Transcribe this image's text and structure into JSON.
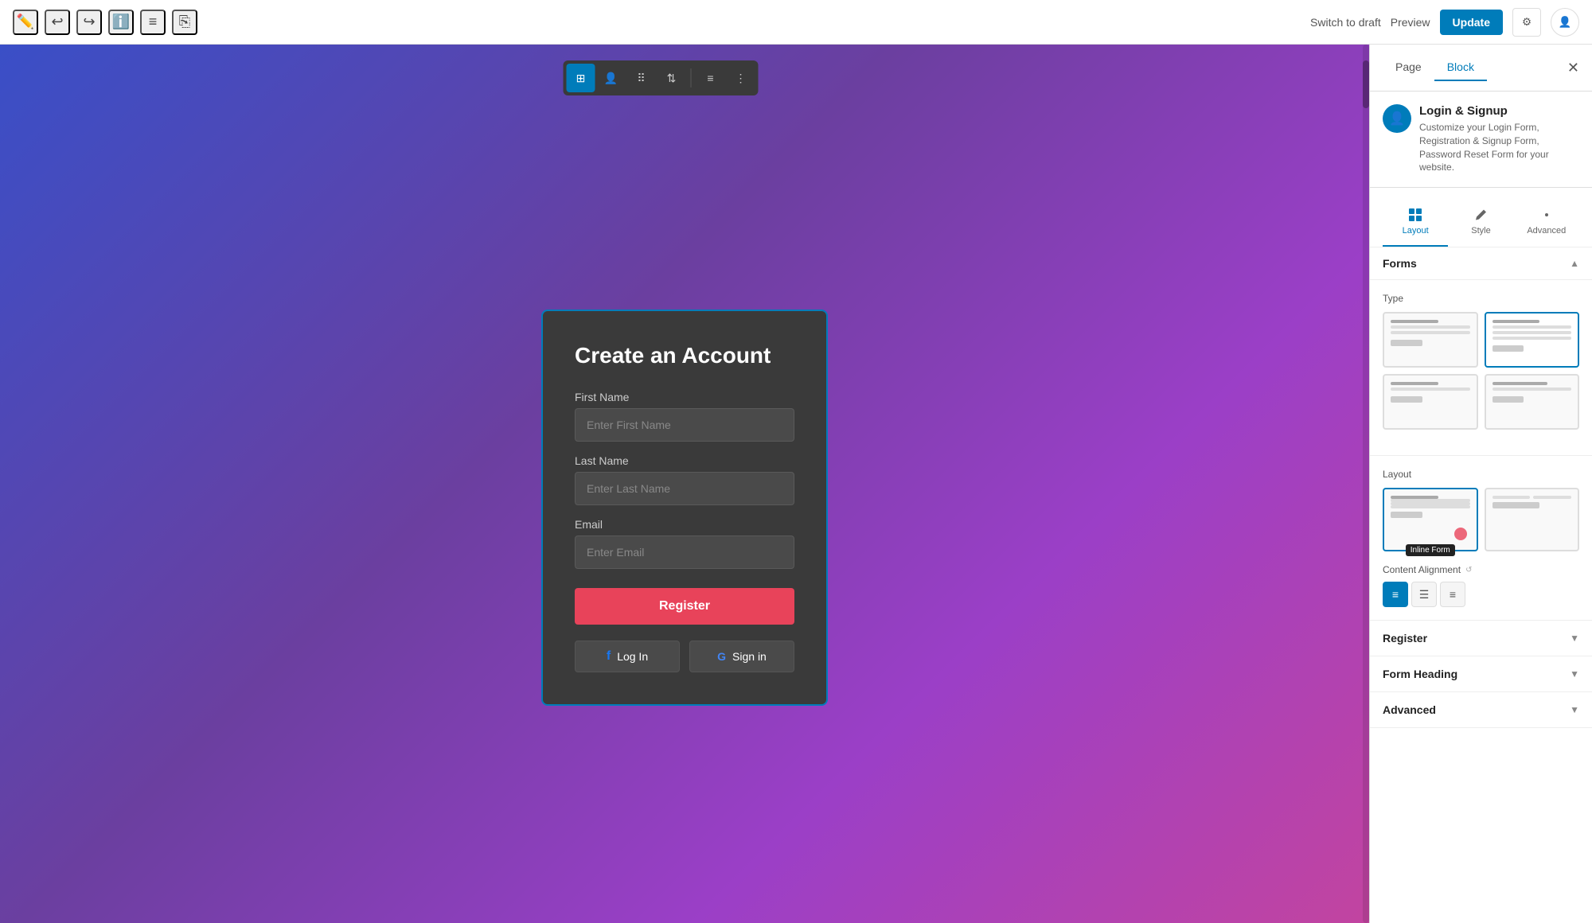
{
  "toolbar": {
    "switch_draft_label": "Switch to draft",
    "preview_label": "Preview",
    "update_label": "Update"
  },
  "panel": {
    "tabs": [
      "Page",
      "Block"
    ],
    "active_tab": "Block",
    "plugin_name": "Login & Signup",
    "plugin_desc": "Customize your Login Form, Registration & Signup Form, Password Reset Form for your website.",
    "tab_icons": [
      "Layout",
      "Style",
      "Advanced"
    ],
    "active_tab_icon": "Layout"
  },
  "forms_section": {
    "label": "Forms",
    "type_label": "Type",
    "types": [
      {
        "id": "type1",
        "label": ""
      },
      {
        "id": "type2",
        "label": "",
        "selected": true
      },
      {
        "id": "type3",
        "label": ""
      },
      {
        "id": "type4",
        "label": ""
      }
    ]
  },
  "layout_section": {
    "label": "Layout",
    "layouts": [
      {
        "id": "inline-form",
        "label": "Inline Form",
        "selected": true,
        "tooltip": "Inline Form"
      },
      {
        "id": "layout2",
        "label": "",
        "selected": false
      }
    ],
    "content_alignment_label": "Content Alignment",
    "alignments": [
      "left",
      "center",
      "right"
    ],
    "active_alignment": "left"
  },
  "form_card": {
    "title": "Create an Account",
    "fields": [
      {
        "label": "First Name",
        "placeholder": "Enter First Name",
        "type": "text"
      },
      {
        "label": "Last Name",
        "placeholder": "Enter Last Name",
        "type": "text"
      },
      {
        "label": "Email",
        "placeholder": "Enter Email",
        "type": "email"
      }
    ],
    "register_button": "Register",
    "social_buttons": [
      {
        "icon": "facebook",
        "label": "Log In"
      },
      {
        "icon": "google",
        "label": "Sign in"
      }
    ]
  },
  "collapsed_sections": [
    {
      "label": "Register"
    },
    {
      "label": "Form Heading"
    },
    {
      "label": "Advanced"
    }
  ]
}
